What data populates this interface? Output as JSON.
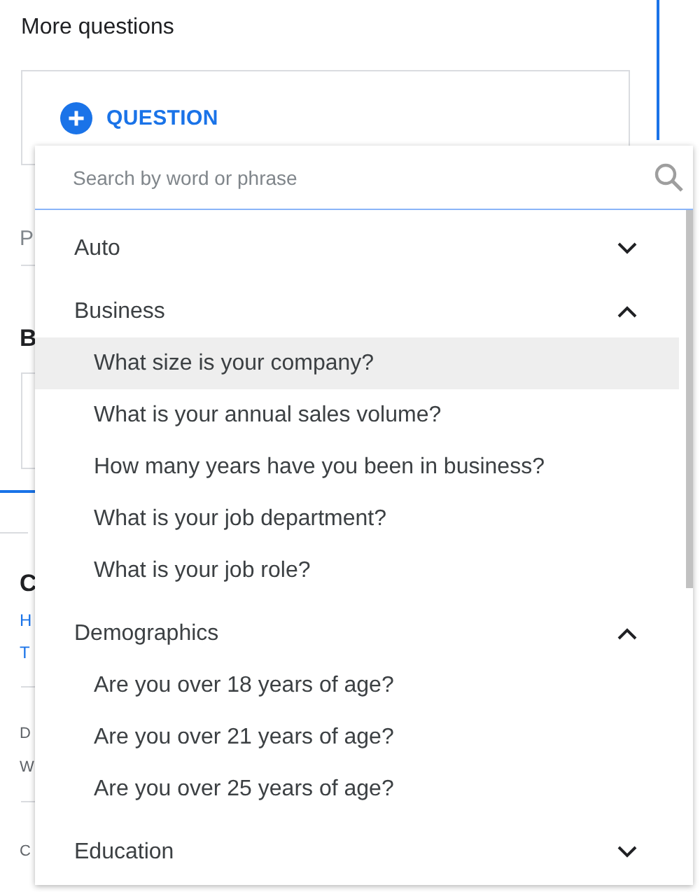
{
  "section": {
    "title": "More questions",
    "add_button": "QUESTION"
  },
  "background_fragments": [
    {
      "kind": "label",
      "text": "P"
    },
    {
      "kind": "heading",
      "text": "B"
    },
    {
      "kind": "heading",
      "text": "C"
    },
    {
      "kind": "link",
      "text": "H"
    },
    {
      "kind": "link",
      "text": "T"
    },
    {
      "kind": "caption",
      "text": "D"
    },
    {
      "kind": "value",
      "text": "W"
    },
    {
      "kind": "caption",
      "text": "C"
    }
  ],
  "dropdown": {
    "search": {
      "placeholder": "Search by word or phrase"
    },
    "categories": [
      {
        "label": "Auto",
        "expanded": false
      },
      {
        "label": "Business",
        "expanded": true,
        "children": [
          {
            "label": "What size is your company?",
            "selected": true
          },
          {
            "label": "What is your annual sales volume?",
            "selected": false
          },
          {
            "label": "How many years have you been in business?",
            "selected": false
          },
          {
            "label": "What is your job department?",
            "selected": false
          },
          {
            "label": "What is your job role?",
            "selected": false
          }
        ]
      },
      {
        "label": "Demographics",
        "expanded": true,
        "children": [
          {
            "label": "Are you over 18 years of age?",
            "selected": false
          },
          {
            "label": "Are you over 21 years of age?",
            "selected": false
          },
          {
            "label": "Are you over 25 years of age?",
            "selected": false
          }
        ]
      },
      {
        "label": "Education",
        "expanded": false
      }
    ]
  }
}
